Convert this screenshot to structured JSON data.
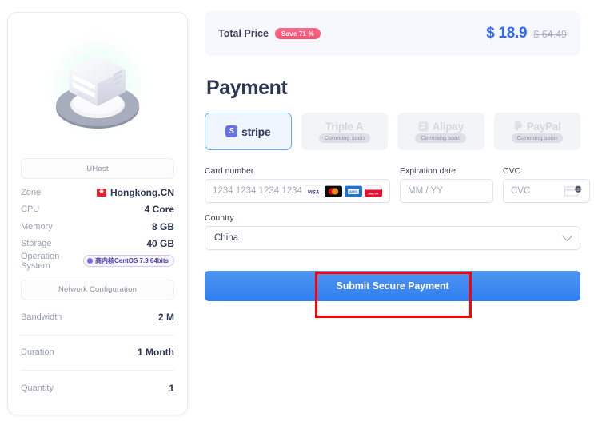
{
  "summary": {
    "illustration_name": "server-illustration",
    "product_chip": "UHost",
    "specs": [
      {
        "key": "Zone",
        "value": "Hongkong.CN",
        "icon": "hongkong-flag-icon"
      },
      {
        "key": "CPU",
        "value": "4 Core"
      },
      {
        "key": "Memory",
        "value": "8 GB"
      },
      {
        "key": "Storage",
        "value": "40 GB"
      },
      {
        "key": "Operation System",
        "value": "高内核CentOS 7.9 64bits",
        "badge": true
      }
    ],
    "network_chip": "Network Configuration",
    "rows": [
      {
        "key": "Bandwidth",
        "value": "2 M"
      },
      {
        "key": "Duration",
        "value": "1 Month"
      },
      {
        "key": "Quantity",
        "value": "1"
      }
    ]
  },
  "total": {
    "label": "Total Price",
    "save_badge": "Save 71 %",
    "price_now": "$ 18.9",
    "price_old": "$ 64.49",
    "price_color": "#2f6df6",
    "badge_color": "#f8516f"
  },
  "heading": "Payment",
  "methods": [
    {
      "name": "stripe",
      "selected": true,
      "soon": ""
    },
    {
      "name": "Triple A",
      "selected": false,
      "soon": "Comming soon"
    },
    {
      "name": "Alipay",
      "selected": false,
      "soon": "Comming soon"
    },
    {
      "name": "PayPal",
      "selected": false,
      "soon": "Comming soon"
    }
  ],
  "form": {
    "card_label": "Card number",
    "card_value": "1234 1234 1234 1234",
    "card_placeholder": "1234 1234 1234 1234",
    "exp_label": "Expiration date",
    "exp_value": "",
    "exp_placeholder": "MM / YY",
    "cvc_label": "CVC",
    "cvc_value": "",
    "cvc_placeholder": "CVC",
    "country_label": "Country",
    "country_value": "China",
    "brands": [
      "visa-icon",
      "mastercard-icon",
      "amex-icon",
      "discover-icon"
    ]
  },
  "submit_label": "Submit Secure Payment",
  "annotation": {
    "name": "red-highlight-box",
    "color": "#fe0000"
  }
}
